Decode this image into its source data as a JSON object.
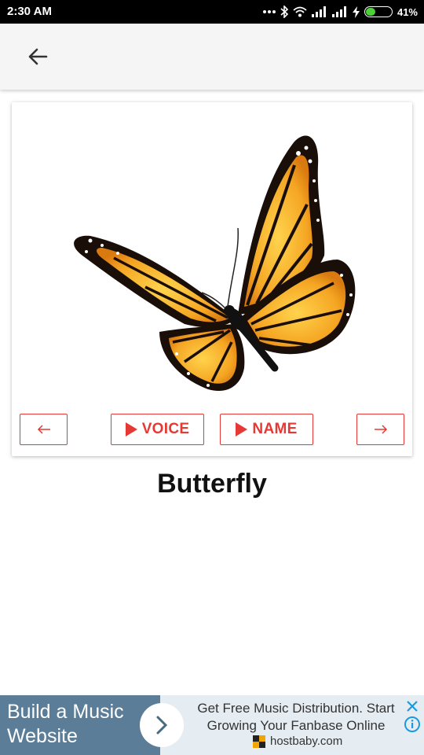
{
  "status_bar": {
    "time": "2:30 AM",
    "battery_text": "41%",
    "battery_level": 0.41,
    "icons": [
      "dots-icon",
      "bluetooth-icon",
      "wifi-icon",
      "signal-icon",
      "signal-icon",
      "charging-icon",
      "battery-icon"
    ]
  },
  "app_bar": {
    "back_icon": "arrow-left-icon"
  },
  "card": {
    "image": "butterfly-illustration",
    "prev_icon": "arrow-left-icon",
    "next_icon": "arrow-right-icon",
    "voice_label": "VOICE",
    "name_label": "NAME",
    "accent_color": "#e53935"
  },
  "animal_name": "Butterfly",
  "ad": {
    "title": "Build a Music Website",
    "description": "Get Free Music Distribution. Start Growing Your Fanbase Online",
    "domain": "hostbaby.com",
    "arrow_icon": "chevron-right-icon",
    "close_icon": "close-icon",
    "info_icon": "info-icon"
  }
}
